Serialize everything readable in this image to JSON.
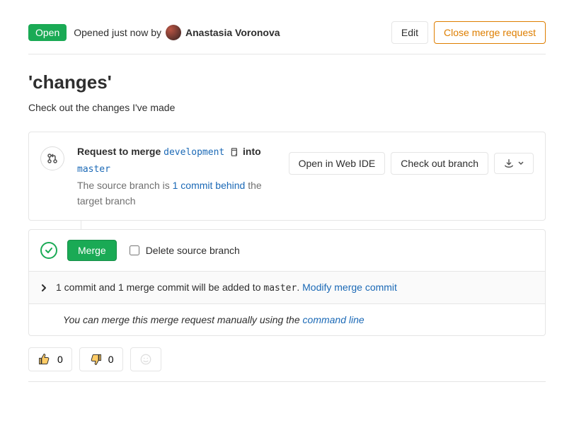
{
  "header": {
    "status_badge": "Open",
    "opened_text": "Opened just now by",
    "author": "Anastasia Voronova",
    "edit_btn": "Edit",
    "close_btn": "Close merge request"
  },
  "mr": {
    "title": "'changes'",
    "description": "Check out the changes I've made"
  },
  "merge_info": {
    "request_prefix": "Request to merge",
    "source_branch": "development",
    "into_word": "into",
    "target_branch": "master",
    "behind_prefix": "The source branch is ",
    "behind_link": "1 commit behind",
    "behind_suffix": " the target branch",
    "open_ide_btn": "Open in Web IDE",
    "checkout_btn": "Check out branch"
  },
  "merge_action": {
    "merge_btn": "Merge",
    "delete_branch_label": "Delete source branch"
  },
  "commit_summary": {
    "one_commit": "1 commit",
    "and_word": " and ",
    "merge_commit": "1 merge commit",
    "added_text": " will be added to ",
    "target": "master",
    "period": ". ",
    "modify_link": "Modify merge commit"
  },
  "manual": {
    "prefix": "You can merge this merge request manually using the ",
    "link": "command line"
  },
  "reactions": {
    "thumbs_up": "0",
    "thumbs_down": "0"
  }
}
